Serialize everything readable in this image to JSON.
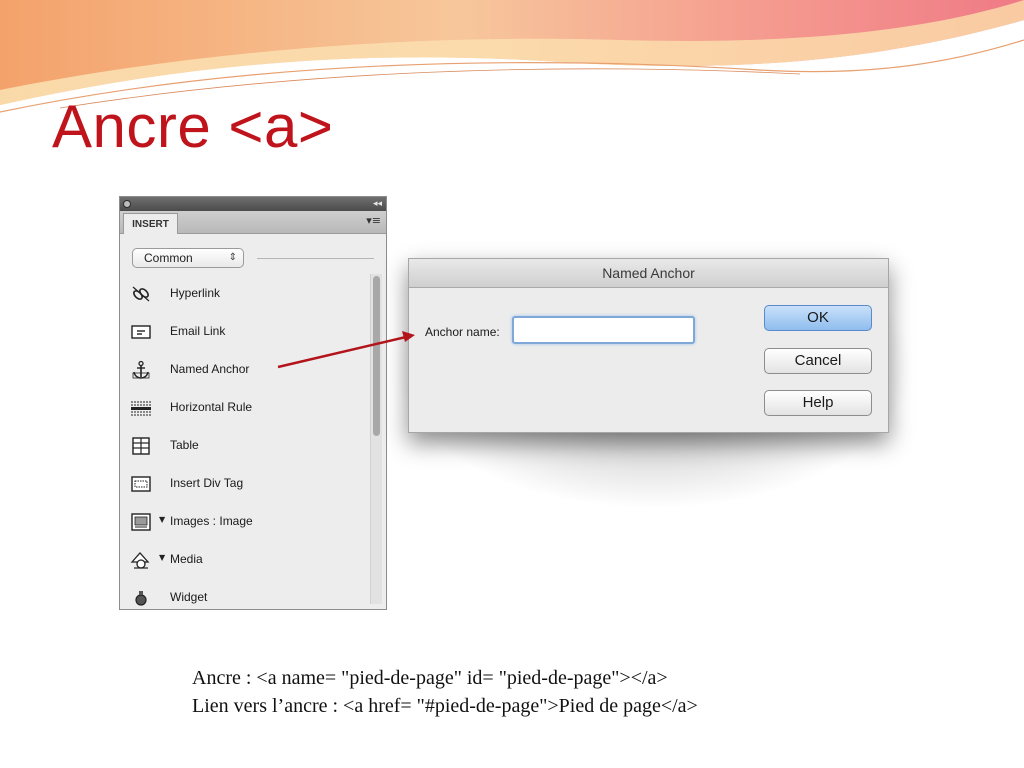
{
  "slide": {
    "title": "Ancre <a>",
    "accent_color": "#c0141c"
  },
  "insert_panel": {
    "tab_label": "INSERT",
    "category": "Common",
    "items": [
      {
        "label": "Hyperlink",
        "icon": "hyperlink-icon"
      },
      {
        "label": "Email Link",
        "icon": "email-link-icon"
      },
      {
        "label": "Named Anchor",
        "icon": "named-anchor-icon"
      },
      {
        "label": "Horizontal Rule",
        "icon": "horizontal-rule-icon"
      },
      {
        "label": "Table",
        "icon": "table-icon"
      },
      {
        "label": "Insert Div Tag",
        "icon": "div-tag-icon"
      },
      {
        "label": "Images : Image",
        "icon": "image-icon",
        "has_dropdown": true
      },
      {
        "label": "Media",
        "icon": "media-icon",
        "has_dropdown": true
      },
      {
        "label": "Widget",
        "icon": "widget-icon"
      }
    ]
  },
  "dialog": {
    "title": "Named Anchor",
    "field_label": "Anchor name:",
    "field_value": "",
    "buttons": {
      "ok": "OK",
      "cancel": "Cancel",
      "help": "Help"
    }
  },
  "code": {
    "line1": "Ancre : <a name= \"pied-de-page\" id= \"pied-de-page\"></a>",
    "line2": "Lien vers l’ancre : <a href= \"#pied-de-page\">Pied de page</a>"
  }
}
